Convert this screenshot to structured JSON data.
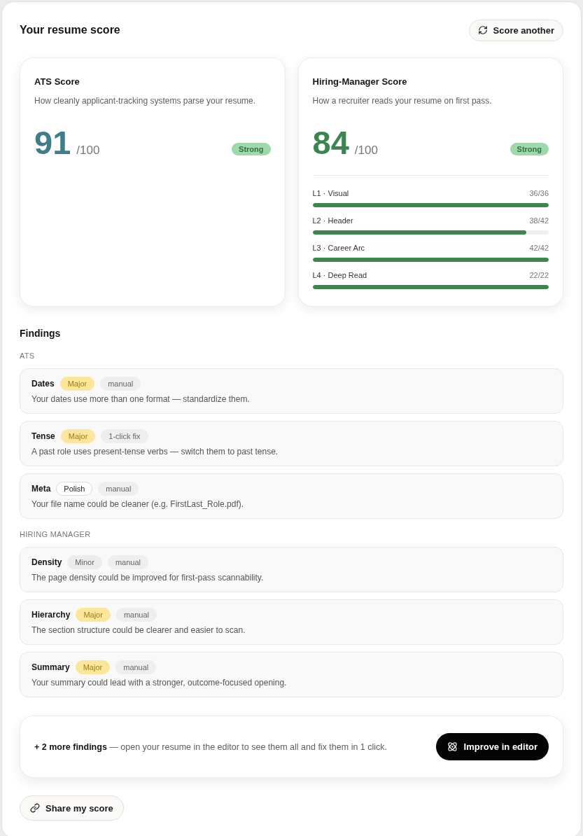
{
  "header": {
    "title": "Your resume score",
    "action": "Score another"
  },
  "score_cards": [
    {
      "title": "ATS Score",
      "description": "How cleanly applicant-tracking systems parse your resume.",
      "score": "91",
      "out_of": "/100",
      "color": "#3f7d88",
      "badge": "Strong"
    },
    {
      "title": "Hiring-Manager Score",
      "description": "How a recruiter reads your resume on first pass.",
      "score": "84",
      "out_of": "/100",
      "color": "#3d8550",
      "badge": "Strong",
      "levels": [
        {
          "label": "L1 · Visual",
          "reading": "36/36",
          "level": 1
        },
        {
          "label": "L2 · Header",
          "reading": "38/42",
          "level": 0.905
        },
        {
          "label": "L3 · Career Arc",
          "reading": "42/42",
          "level": 1
        },
        {
          "label": "L4 · Deep Read",
          "reading": "22/22",
          "level": 1
        }
      ]
    }
  ],
  "findings": {
    "title": "Findings",
    "groups": [
      {
        "label": "ATS",
        "items": [
          {
            "title": "Dates",
            "tags": [
              {
                "label": "Major",
                "kind": "major"
              },
              {
                "label": "manual",
                "kind": "fix"
              }
            ],
            "description": "Your dates use more than one format — standardize them."
          },
          {
            "title": "Tense",
            "tags": [
              {
                "label": "Major",
                "kind": "major"
              },
              {
                "label": "1-click fix",
                "kind": "fix"
              }
            ],
            "description": "A past role uses present-tense verbs — switch them to past tense."
          },
          {
            "title": "Meta",
            "tags": [
              {
                "label": "Polish",
                "kind": "polish"
              },
              {
                "label": "manual",
                "kind": "fix"
              }
            ],
            "description": "Your file name could be cleaner (e.g. FirstLast_Role.pdf)."
          }
        ]
      },
      {
        "label": "HIRING MANAGER",
        "items": [
          {
            "title": "Density",
            "tags": [
              {
                "label": "Minor",
                "kind": "minor"
              },
              {
                "label": "manual",
                "kind": "fix"
              }
            ],
            "description": "The page density could be improved for first-pass scannability."
          },
          {
            "title": "Hierarchy",
            "tags": [
              {
                "label": "Major",
                "kind": "major"
              },
              {
                "label": "manual",
                "kind": "fix"
              }
            ],
            "description": "The section structure could be clearer and easier to scan."
          },
          {
            "title": "Summary",
            "tags": [
              {
                "label": "Major",
                "kind": "major"
              },
              {
                "label": "manual",
                "kind": "fix"
              }
            ],
            "description": "Your summary could lead with a stronger, outcome-focused opening."
          }
        ]
      }
    ]
  },
  "cta": {
    "text": "**+ 2 more findings** — open your resume in the editor to see them all and fix them in 1 click.",
    "button": "Improve in editor"
  },
  "share_button": "Share my score"
}
